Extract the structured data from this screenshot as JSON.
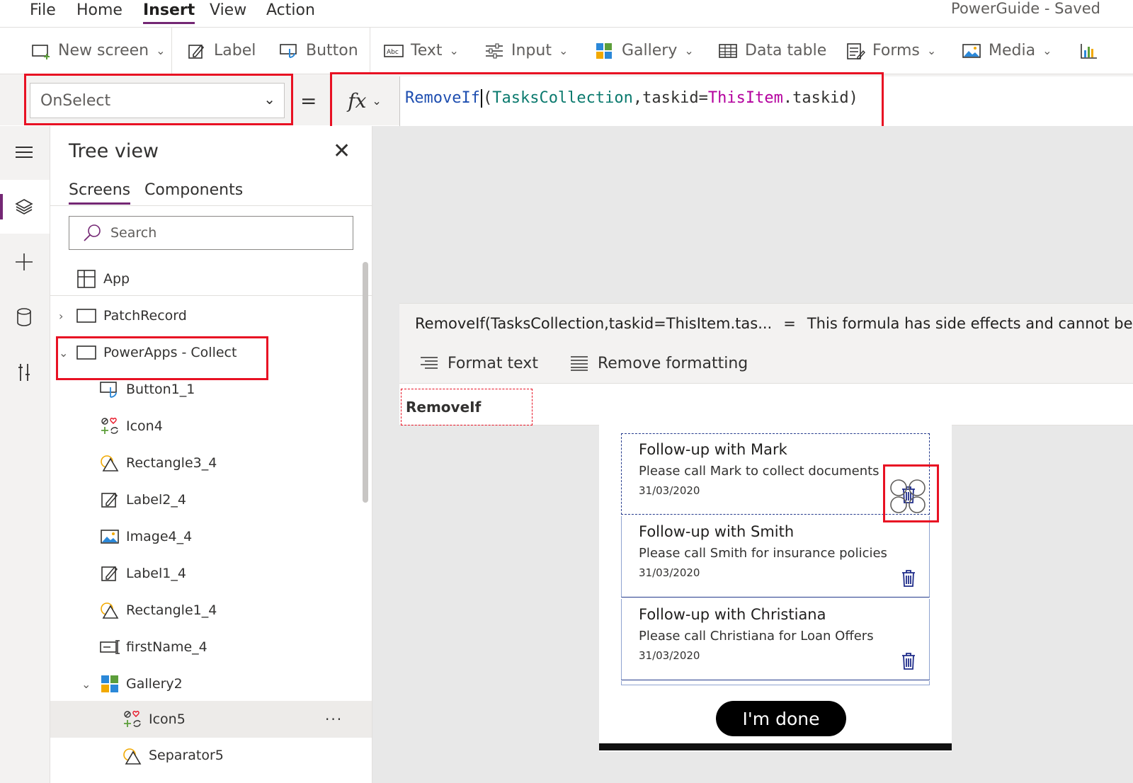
{
  "menu": {
    "items": [
      "File",
      "Home",
      "Insert",
      "View",
      "Action"
    ],
    "active": "Insert"
  },
  "app_title": "PowerGuide - Saved",
  "ribbon": {
    "new_screen": "New screen",
    "label": "Label",
    "button": "Button",
    "text": "Text",
    "input": "Input",
    "gallery": "Gallery",
    "data_table": "Data table",
    "forms": "Forms",
    "media": "Media"
  },
  "property": {
    "selected": "OnSelect",
    "equals": "="
  },
  "formula": {
    "fn": "RemoveIf",
    "open": "(",
    "collection": "TasksCollection",
    "mid": ",taskid=",
    "this": "ThisItem",
    "field": ".taskid",
    "close": ")"
  },
  "formula_result": {
    "expr": "RemoveIf(TasksCollection,taskid=ThisItem.tas...",
    "equals": "=",
    "message": "This formula has side effects and cannot be ev"
  },
  "format_bar": {
    "format_text": "Format text",
    "remove_formatting": "Remove formatting"
  },
  "suggestion": "RemoveIf",
  "tree_view": {
    "title": "Tree view",
    "tabs": [
      "Screens",
      "Components"
    ],
    "active_tab": "Screens",
    "search_placeholder": "Search",
    "items": {
      "app": "App",
      "patch_record": "PatchRecord",
      "collect": "PowerApps - Collect",
      "button1_1": "Button1_1",
      "icon4": "Icon4",
      "rectangle3_4": "Rectangle3_4",
      "label2_4": "Label2_4",
      "image4_4": "Image4_4",
      "label1_4": "Label1_4",
      "rectangle1_4": "Rectangle1_4",
      "firstname_4": "firstName_4",
      "gallery2": "Gallery2",
      "icon5": "Icon5",
      "separator5": "Separator5"
    },
    "more": "···"
  },
  "gallery": [
    {
      "title": "Follow-up with Mark",
      "subtitle": "Please call Mark to collect documents",
      "date": "31/03/2020"
    },
    {
      "title": "Follow-up with Smith",
      "subtitle": "Please call Smith for insurance policies",
      "date": "31/03/2020"
    },
    {
      "title": "Follow-up with Christiana",
      "subtitle": "Please call Christiana for Loan Offers",
      "date": "31/03/2020"
    }
  ],
  "done_button": "I'm done",
  "colors": {
    "accent": "#742774",
    "highlight": "#e81123",
    "trash": "#1f2c8a"
  }
}
